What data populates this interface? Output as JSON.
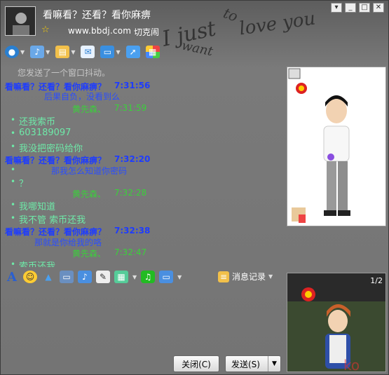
{
  "window": {
    "title": "看嘛看？还看？看你麻痹",
    "url": "www.bbdj.com",
    "url_suffix": "切克闹",
    "deco_lines": [
      "I just",
      "to",
      "love you",
      "want"
    ]
  },
  "toolbar": {
    "items": [
      "video-icon",
      "mic-icon",
      "folder-icon",
      "sms-icon",
      "screen-icon",
      "share-icon",
      "apps-icon"
    ]
  },
  "chat": {
    "system": "您发送了一个窗口抖动。",
    "lines": [
      {
        "type": "hdr-a",
        "text": "看嘛看？还看？看你麻痹？",
        "time": "7:31:56"
      },
      {
        "type": "msg-a",
        "text": "后果自负，没看到么"
      },
      {
        "type": "hdr-b",
        "text": "黄先森、",
        "time": "7:31:59"
      },
      {
        "type": "msg-b",
        "text": "还我索币"
      },
      {
        "type": "msg-b",
        "text": "603189097"
      },
      {
        "type": "msg-b",
        "text": "我没把密码给你"
      },
      {
        "type": "hdr-a",
        "text": "看嘛看？还看？看你麻痹？",
        "time": "7:32:20"
      },
      {
        "type": "msg-a",
        "text": "那我怎么知道你密码"
      },
      {
        "type": "msg-b",
        "text": "？"
      },
      {
        "type": "hdr-b",
        "text": "黄先森、",
        "time": "7:32:28"
      },
      {
        "type": "msg-b",
        "text": "我哪知道"
      },
      {
        "type": "msg-b",
        "text": "我不管    索币还我"
      },
      {
        "type": "hdr-a",
        "text": "看嘛看？还看？看你麻痹？",
        "time": "7:32:38"
      },
      {
        "type": "msg-a",
        "text": "那就是你给我的咯"
      },
      {
        "type": "hdr-b",
        "text": "黄先森、",
        "time": "7:32:47"
      },
      {
        "type": "msg-b",
        "text": "索币还我"
      }
    ]
  },
  "input_toolbar": {
    "history_label": "消息记录",
    "page": "1/2"
  },
  "buttons": {
    "close": "关闭(C)",
    "send": "发送(S)"
  },
  "colors": {
    "accent": "#1e3cff",
    "peer": "#6ee9a8",
    "bg": "#6e6e6e"
  }
}
